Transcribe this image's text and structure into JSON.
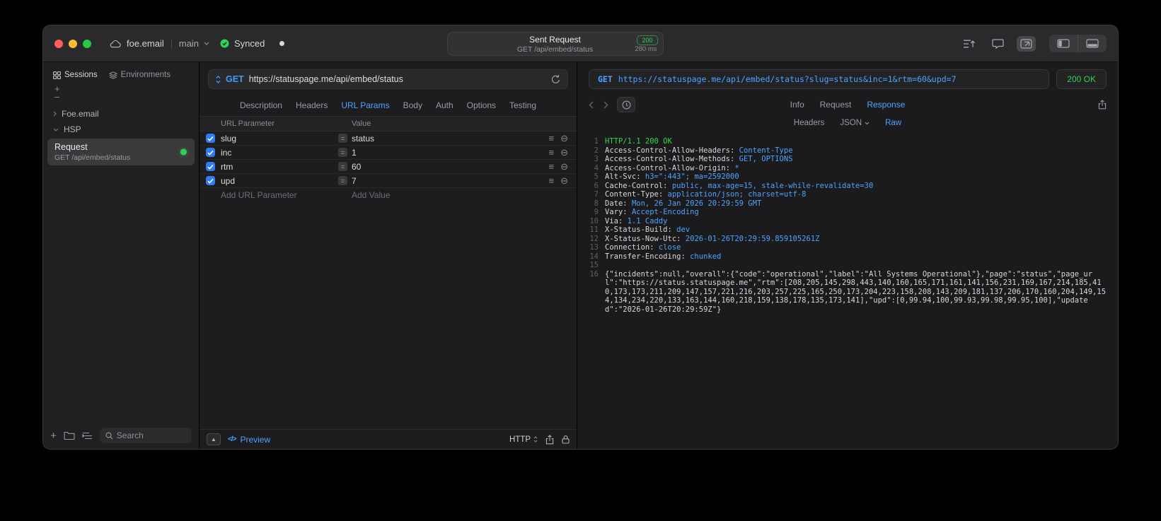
{
  "colors": {
    "accent_blue": "#4da2ff",
    "method_blue": "#3f9bfc",
    "success_green": "#30d158",
    "window_bg": "#1d1d1f"
  },
  "titlebar": {
    "project": "foe.email",
    "branch": "main",
    "sync": "Synced",
    "request_summary": {
      "title": "Sent Request",
      "status_code": "200",
      "method_path": "GET /api/embed/status",
      "duration": "280 ms"
    }
  },
  "sidebar": {
    "tabs": [
      {
        "label": "Sessions"
      },
      {
        "label": "Environments"
      }
    ],
    "groups": [
      {
        "label": "Foe.email"
      },
      {
        "label": "HSP"
      }
    ],
    "request_item": {
      "title": "Request",
      "subtitle": "GET /api/embed/status"
    },
    "search_placeholder": "Search"
  },
  "request_panel": {
    "method": "GET",
    "url": "https://statuspage.me/api/embed/status",
    "tabs": [
      "Description",
      "Headers",
      "URL Params",
      "Body",
      "Auth",
      "Options",
      "Testing"
    ],
    "active_tab": "URL Params",
    "params": {
      "columns": [
        "URL Parameter",
        "Value"
      ],
      "rows": [
        {
          "name": "slug",
          "value": "status",
          "checked": true
        },
        {
          "name": "inc",
          "value": "1",
          "checked": true
        },
        {
          "name": "rtm",
          "value": "60",
          "checked": true
        },
        {
          "name": "upd",
          "value": "7",
          "checked": true
        }
      ],
      "add_param_placeholder": "Add URL Parameter",
      "add_value_placeholder": "Add Value"
    },
    "footer": {
      "preview": "Preview",
      "protocol": "HTTP"
    }
  },
  "response_panel": {
    "method": "GET",
    "url": "https://statuspage.me/api/embed/status?slug=status&inc=1&rtm=60&upd=7",
    "status": "200 OK",
    "tabs": [
      "Info",
      "Request",
      "Response"
    ],
    "active_tab": "Response",
    "subtabs": [
      "Headers",
      "JSON",
      "Raw"
    ],
    "active_subtab": "Raw",
    "lines": [
      {
        "n": 1,
        "parts": [
          {
            "t": "HTTP/1.1 200 OK",
            "c": "status"
          }
        ]
      },
      {
        "n": 2,
        "parts": [
          {
            "t": "Access-Control-Allow-Headers: ",
            "c": "name"
          },
          {
            "t": "Content-Type",
            "c": "value"
          }
        ]
      },
      {
        "n": 3,
        "parts": [
          {
            "t": "Access-Control-Allow-Methods: ",
            "c": "name"
          },
          {
            "t": "GET, OPTIONS",
            "c": "value"
          }
        ]
      },
      {
        "n": 4,
        "parts": [
          {
            "t": "Access-Control-Allow-Origin: ",
            "c": "name"
          },
          {
            "t": "*",
            "c": "value"
          }
        ]
      },
      {
        "n": 5,
        "parts": [
          {
            "t": "Alt-Svc: ",
            "c": "name"
          },
          {
            "t": "h3=\":443\"; ma=2592000",
            "c": "value"
          }
        ]
      },
      {
        "n": 6,
        "parts": [
          {
            "t": "Cache-Control: ",
            "c": "name"
          },
          {
            "t": "public, max-age=15, stale-while-revalidate=30",
            "c": "value"
          }
        ]
      },
      {
        "n": 7,
        "parts": [
          {
            "t": "Content-Type: ",
            "c": "name"
          },
          {
            "t": "application/json; charset=utf-8",
            "c": "value"
          }
        ]
      },
      {
        "n": 8,
        "parts": [
          {
            "t": "Date: ",
            "c": "name"
          },
          {
            "t": "Mon, 26 Jan 2026 20:29:59 GMT",
            "c": "value"
          }
        ]
      },
      {
        "n": 9,
        "parts": [
          {
            "t": "Vary: ",
            "c": "name"
          },
          {
            "t": "Accept-Encoding",
            "c": "value"
          }
        ]
      },
      {
        "n": 10,
        "parts": [
          {
            "t": "Via: ",
            "c": "name"
          },
          {
            "t": "1.1 Caddy",
            "c": "value"
          }
        ]
      },
      {
        "n": 11,
        "parts": [
          {
            "t": "X-Status-Build: ",
            "c": "name"
          },
          {
            "t": "dev",
            "c": "value"
          }
        ]
      },
      {
        "n": 12,
        "parts": [
          {
            "t": "X-Status-Now-Utc: ",
            "c": "name"
          },
          {
            "t": "2026-01-26T20:29:59.859105261Z",
            "c": "value"
          }
        ]
      },
      {
        "n": 13,
        "parts": [
          {
            "t": "Connection: ",
            "c": "name"
          },
          {
            "t": "close",
            "c": "value"
          }
        ]
      },
      {
        "n": 14,
        "parts": [
          {
            "t": "Transfer-Encoding: ",
            "c": "name"
          },
          {
            "t": "chunked",
            "c": "value"
          }
        ]
      },
      {
        "n": 15,
        "parts": []
      },
      {
        "n": 16,
        "parts": [
          {
            "t": "{\"incidents\":null,\"overall\":{\"code\":\"operational\",\"label\":\"All Systems Operational\"},\"page\":\"status\",\"page_url\":\"https://status.statuspage.me\",\"rtm\":[208,205,145,298,443,140,160,165,171,161,141,156,231,169,167,214,185,410,173,173,211,209,147,157,221,216,203,257,225,165,250,173,204,223,158,208,143,209,181,137,206,170,160,204,149,154,134,234,220,133,163,144,160,218,159,138,178,135,173,141],\"upd\":[0,99.94,100,99.93,99.98,99.95,100],\"updated\":\"2026-01-26T20:29:59Z\"}",
            "c": "body"
          }
        ]
      }
    ]
  }
}
